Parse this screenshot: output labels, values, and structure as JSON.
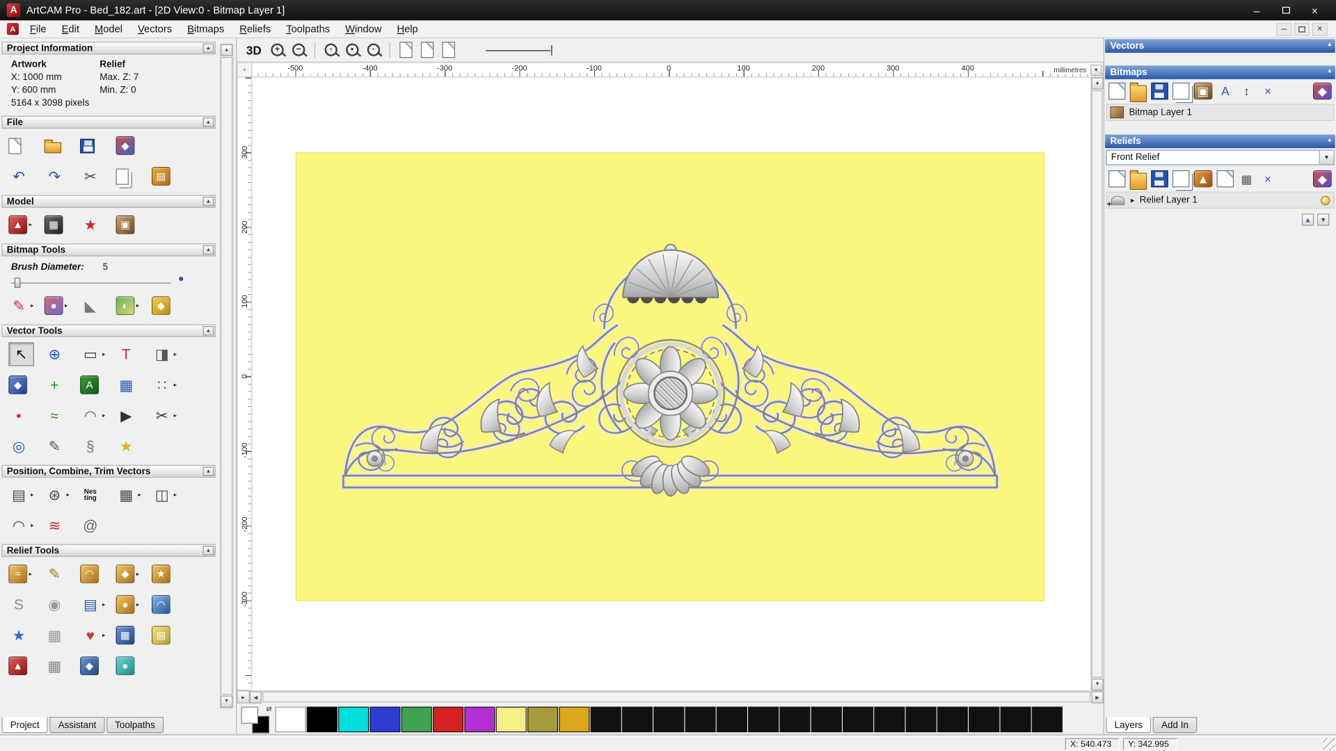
{
  "window": {
    "title": "ArtCAM Pro - Bed_182.art - [2D View:0 - Bitmap Layer 1]",
    "app_icon_letter": "A",
    "controls": {
      "minimize": "–",
      "close": "×"
    }
  },
  "ui": {
    "up": "▲",
    "down": "▼",
    "left": "◀",
    "right": "▶",
    "flyout": "▸",
    "dd": "▼",
    "corner": "+",
    "expander": "▸",
    "link": "⇄",
    "plus": "+"
  },
  "menu": {
    "items": [
      "File",
      "Edit",
      "Model",
      "Vectors",
      "Bitmaps",
      "Reliefs",
      "Toolpaths",
      "Window",
      "Help"
    ]
  },
  "left_panel": {
    "project_info": {
      "title": "Project Information",
      "artwork_label": "Artwork",
      "relief_label": "Relief",
      "x": "X: 1000 mm",
      "y": "Y: 600 mm",
      "max_z": "Max. Z: 7",
      "min_z": "Min. Z: 0",
      "pixels": "5164 x 3098 pixels"
    },
    "file": {
      "title": "File",
      "row1": [
        {
          "name": "new-model-icon",
          "kind": "doc"
        },
        {
          "name": "open-model-icon",
          "kind": "folder"
        },
        {
          "name": "save-model-icon",
          "kind": "save"
        },
        {
          "name": "import-model-icon",
          "kind": "badge",
          "glyph": "◆",
          "grad": [
            "#d05050",
            "#3b62c4"
          ]
        }
      ],
      "row2": [
        {
          "name": "undo-icon",
          "kind": "glyph",
          "glyph": "↶",
          "fg": "#2458b0"
        },
        {
          "name": "redo-icon",
          "kind": "glyph",
          "glyph": "↷",
          "fg": "#2458b0"
        },
        {
          "name": "cut-icon",
          "kind": "glyph",
          "glyph": "✂",
          "fg": "#444444"
        },
        {
          "name": "copy-icon",
          "kind": "doc2"
        },
        {
          "name": "paste-icon",
          "kind": "badge",
          "glyph": "▤",
          "grad": [
            "#e8b040",
            "#b06a20"
          ]
        }
      ]
    },
    "model": {
      "title": "Model",
      "row1": [
        {
          "name": "greyscale-model-icon",
          "kind": "badge",
          "glyph": "▲",
          "grad": [
            "#e06060",
            "#8a1010"
          ],
          "flyout": true
        },
        {
          "name": "texture-model-icon",
          "kind": "badge",
          "glyph": "▦",
          "grad": [
            "#666666",
            "#222222"
          ]
        },
        {
          "name": "stamp-model-icon",
          "kind": "glyph",
          "glyph": "★",
          "fg": "#c23030"
        },
        {
          "name": "picture-model-icon",
          "kind": "badge",
          "glyph": "▣",
          "grad": [
            "#caa46a",
            "#6a4a2a"
          ]
        }
      ]
    },
    "bitmap_tools": {
      "title": "Bitmap Tools",
      "brush_label": "Brush Diameter:",
      "brush_value": "5",
      "row1": [
        {
          "name": "paint-icon",
          "kind": "glyph",
          "glyph": "✎",
          "fg": "#c23030",
          "flyout": true
        },
        {
          "name": "colour-palette-icon",
          "kind": "badge",
          "glyph": "●",
          "grad": [
            "#d86a6a",
            "#6a6ad8"
          ],
          "flyout": true
        },
        {
          "name": "colour-picker-icon",
          "kind": "glyph",
          "glyph": "◣",
          "fg": "#777777"
        },
        {
          "name": "paint-selective-icon",
          "kind": "badge",
          "glyph": "◐",
          "grad": [
            "#6ab06a",
            "#d8d86a"
          ],
          "flyout": true
        },
        {
          "name": "flood-fill-icon",
          "kind": "badge",
          "glyph": "◆",
          "grad": [
            "#f0d050",
            "#bf8a20"
          ]
        }
      ]
    },
    "vector_tools": {
      "title": "Vector Tools",
      "row1": [
        {
          "name": "select-vectors-icon",
          "kind": "glyph",
          "glyph": "↖",
          "fg": "#111111",
          "sel": true
        },
        {
          "name": "transform-vectors-icon",
          "kind": "glyph",
          "glyph": "⊕",
          "fg": "#2458b0"
        },
        {
          "name": "create-rectangle-icon",
          "kind": "glyph",
          "glyph": "▭",
          "fg": "#333333",
          "flyout": true
        },
        {
          "name": "create-text-icon",
          "kind": "glyph",
          "glyph": "T",
          "fg": "#c23030"
        },
        {
          "name": "mirror-vectors-icon",
          "kind": "glyph",
          "glyph": "◨",
          "fg": "#555555",
          "flyout": true
        }
      ],
      "row2": [
        {
          "name": "offset-vectors-icon",
          "kind": "badge",
          "glyph": "◆",
          "grad": [
            "#6a8ad8",
            "#24418a"
          ]
        },
        {
          "name": "create-polyline-icon",
          "kind": "glyph",
          "glyph": "+",
          "fg": "#169016"
        },
        {
          "name": "wrap-text-icon",
          "kind": "badge",
          "glyph": "A",
          "grad": [
            "#3a9a3a",
            "#1a5a1a"
          ]
        },
        {
          "name": "paste-along-curve-icon",
          "kind": "glyph",
          "glyph": "▦",
          "fg": "#2458b0"
        },
        {
          "name": "array-copy-icon",
          "kind": "glyph",
          "glyph": "∷",
          "fg": "#c23030",
          "flyout": true
        }
      ],
      "row3": [
        {
          "name": "create-dot-icon",
          "kind": "glyph",
          "glyph": "•",
          "fg": "#c23030"
        },
        {
          "name": "freehand-draw-icon",
          "kind": "glyph",
          "glyph": "≈",
          "fg": "#169016"
        },
        {
          "name": "create-arc-icon",
          "kind": "glyph",
          "glyph": "◠",
          "fg": "#555555",
          "flyout": true
        },
        {
          "name": "create-polyline-arrow-icon",
          "kind": "glyph",
          "glyph": "▶",
          "fg": "#333333"
        },
        {
          "name": "trim-vectors-icon",
          "kind": "glyph",
          "glyph": "✂",
          "fg": "#333333",
          "flyout": true
        }
      ],
      "row4": [
        {
          "name": "create-circle-icon",
          "kind": "glyph",
          "glyph": "◎",
          "fg": "#2458b0"
        },
        {
          "name": "fit-curve-icon",
          "kind": "glyph",
          "glyph": "✎",
          "fg": "#555555"
        },
        {
          "name": "measure-icon",
          "kind": "glyph",
          "glyph": "§",
          "fg": "#777777"
        },
        {
          "name": "create-star-icon",
          "kind": "glyph",
          "glyph": "★",
          "fg": "#e0b020"
        }
      ]
    },
    "position_tools": {
      "title": "Position, Combine, Trim Vectors",
      "row1": [
        {
          "name": "align-vectors-icon",
          "kind": "glyph",
          "glyph": "▤",
          "fg": "#444444",
          "flyout": true
        },
        {
          "name": "block-rotate-copy-icon",
          "kind": "glyph",
          "glyph": "⊛",
          "fg": "#444444",
          "flyout": true
        },
        {
          "name": "nesting-icon",
          "kind": "smalltext",
          "glyph": "Nes\nting"
        },
        {
          "name": "block-array-copy-icon",
          "kind": "glyph",
          "glyph": "▦",
          "fg": "#444444",
          "flyout": true
        },
        {
          "name": "group-vectors-icon",
          "kind": "glyph",
          "glyph": "◫",
          "fg": "#444444",
          "flyout": true
        }
      ],
      "row2": [
        {
          "name": "join-vectors-icon",
          "kind": "glyph",
          "glyph": "◠",
          "fg": "#444444",
          "flyout": true
        },
        {
          "name": "envelope-distort-icon",
          "kind": "glyph",
          "glyph": "≋",
          "fg": "#c23030"
        },
        {
          "name": "wrap-spiral-icon",
          "kind": "glyph",
          "glyph": "@",
          "fg": "#666666"
        }
      ]
    },
    "relief_tools": {
      "title": "Relief Tools",
      "row1": [
        {
          "name": "sculpt-relief-icon",
          "kind": "badge",
          "glyph": "≈",
          "grad": [
            "#f0c860",
            "#a87020"
          ],
          "flyout": true
        },
        {
          "name": "carve-relief-icon",
          "kind": "glyph",
          "glyph": "✎",
          "fg": "#a87820"
        },
        {
          "name": "extrude-relief-icon",
          "kind": "badge",
          "glyph": "◠",
          "grad": [
            "#f0c860",
            "#a87020"
          ]
        },
        {
          "name": "turn-relief-icon",
          "kind": "badge",
          "glyph": "◆",
          "grad": [
            "#f0c860",
            "#a87020"
          ],
          "flyout": true
        },
        {
          "name": "two-rail-sweep-icon",
          "kind": "badge",
          "glyph": "★",
          "grad": [
            "#f0c860",
            "#a87020"
          ]
        }
      ],
      "row2": [
        {
          "name": "smooth-relief-icon",
          "kind": "glyph",
          "glyph": "S",
          "fg": "#8a8a8a"
        },
        {
          "name": "weave-relief-icon",
          "kind": "glyph",
          "glyph": "◉",
          "fg": "#9a9a9a"
        },
        {
          "name": "relief-layer-stack-icon",
          "kind": "glyph",
          "glyph": "▤",
          "fg": "#2458b0",
          "flyout": true
        },
        {
          "name": "add-clay-icon",
          "kind": "badge",
          "glyph": "●",
          "grad": [
            "#f0c860",
            "#a87020"
          ],
          "flyout": true
        },
        {
          "name": "dome-relief-icon",
          "kind": "badge",
          "glyph": "◠",
          "grad": [
            "#8ab4e8",
            "#2a5a9a"
          ]
        }
      ],
      "row3": [
        {
          "name": "texture-star-icon",
          "kind": "glyph",
          "glyph": "★",
          "fg": "#3a6ac4"
        },
        {
          "name": "mesh-relief-icon",
          "kind": "glyph",
          "glyph": "▦",
          "fg": "#9a9a9a"
        },
        {
          "name": "petal-relief-icon",
          "kind": "glyph",
          "glyph": "♥",
          "fg": "#c04040",
          "flyout": true
        },
        {
          "name": "texture-area-icon",
          "kind": "badge",
          "glyph": "▦",
          "grad": [
            "#6a94d4",
            "#24487e"
          ]
        },
        {
          "name": "offset-relief-icon",
          "kind": "badge",
          "glyph": "▤",
          "grad": [
            "#f0e080",
            "#baa030"
          ]
        }
      ],
      "row4": [
        {
          "name": "clipart-relief-icon",
          "kind": "badge",
          "glyph": "▲",
          "grad": [
            "#e06060",
            "#8a1010"
          ]
        },
        {
          "name": "grid-relief-icon",
          "kind": "glyph",
          "glyph": "▦",
          "fg": "#888888"
        },
        {
          "name": "blue-relief-icon",
          "kind": "badge",
          "glyph": "◆",
          "grad": [
            "#6a94d4",
            "#24487e"
          ]
        },
        {
          "name": "teal-relief-icon",
          "kind": "badge",
          "glyph": "●",
          "grad": [
            "#6ad4d4",
            "#248a8a"
          ]
        }
      ]
    },
    "tabs": [
      "Project",
      "Assistant",
      "Toolpaths"
    ]
  },
  "canvas": {
    "toolbar": {
      "view_3d": "3D",
      "items": [
        {
          "name": "zoom-in-icon",
          "kind": "lens",
          "glyph": "+"
        },
        {
          "name": "zoom-out-icon",
          "kind": "lens",
          "glyph": "−"
        },
        {
          "kind": "sep"
        },
        {
          "name": "zoom-objects-icon",
          "kind": "lens",
          "glyph": "▫"
        },
        {
          "name": "zoom-drawing-icon",
          "kind": "lens",
          "glyph": "▪"
        },
        {
          "name": "zoom-previous-icon",
          "kind": "lens",
          "glyph": "·"
        },
        {
          "kind": "sep"
        },
        {
          "name": "page-snap-icon",
          "kind": "doc"
        },
        {
          "name": "page-grid-icon",
          "kind": "doc"
        },
        {
          "name": "page-preview-icon",
          "kind": "doc"
        }
      ]
    },
    "ruler_top": {
      "labels": [
        "-500",
        "-400",
        "-300",
        "-200",
        "-100",
        "0",
        "100",
        "200",
        "300",
        "400"
      ],
      "unit": "millimetres"
    },
    "ruler_left": {
      "labels": [
        "300",
        "200",
        "100",
        "0",
        "-100",
        "-200",
        "-300"
      ]
    }
  },
  "right_panel": {
    "vectors": {
      "title": "Vectors"
    },
    "bitmaps": {
      "title": "Bitmaps",
      "layer_label": "Bitmap Layer 1",
      "toolbar": [
        {
          "name": "new-bitmap-layer-icon",
          "kind": "doc"
        },
        {
          "name": "open-bitmap-layer-icon",
          "kind": "folder"
        },
        {
          "name": "save-bitmap-layer-icon",
          "kind": "save"
        },
        {
          "name": "duplicate-bitmap-layer-icon",
          "kind": "doc2"
        },
        {
          "name": "bitmap-colour-icon",
          "kind": "badge",
          "glyph": "▣",
          "grad": [
            "#caa46a",
            "#6a4a2a"
          ]
        },
        {
          "name": "bitmap-text-icon",
          "kind": "glyph",
          "glyph": "A",
          "fg": "#2458b0"
        },
        {
          "name": "bitmap-transfer-icon",
          "kind": "glyph",
          "glyph": "↕",
          "fg": "#444444"
        },
        {
          "name": "delete-bitmap-layer-icon",
          "kind": "glyph",
          "glyph": "×",
          "fg": "#2458b0"
        },
        {
          "name": "bitmap-options-icon",
          "kind": "badge",
          "glyph": "◆",
          "grad": [
            "#d05050",
            "#5050d0"
          ],
          "right": true
        }
      ]
    },
    "reliefs": {
      "title": "Reliefs",
      "combo_value": "Front Relief",
      "layer_label": "Relief Layer 1",
      "toolbar": [
        {
          "name": "new-relief-layer-icon",
          "kind": "doc"
        },
        {
          "name": "open-relief-layer-icon",
          "kind": "folder"
        },
        {
          "name": "save-relief-layer-icon",
          "kind": "save"
        },
        {
          "name": "duplicate-relief-layer-icon",
          "kind": "doc2"
        },
        {
          "name": "calculate-relief-icon",
          "kind": "badge",
          "glyph": "▲",
          "grad": [
            "#e0a040",
            "#a05010"
          ]
        },
        {
          "name": "relief-sheet-icon",
          "kind": "doc"
        },
        {
          "name": "relief-calculator-icon",
          "kind": "glyph",
          "glyph": "▦",
          "fg": "#555555"
        },
        {
          "name": "delete-relief-layer-icon",
          "kind": "glyph",
          "glyph": "×",
          "fg": "#2458b0"
        },
        {
          "name": "relief-options-icon",
          "kind": "badge",
          "glyph": "◆",
          "grad": [
            "#d05050",
            "#5050d0"
          ],
          "right": true
        }
      ]
    },
    "tabs": [
      "Layers",
      "Add In"
    ]
  },
  "status_bar": {
    "x_readout": "X: 540.473",
    "y_readout": "Y: 342.995"
  },
  "palette": {
    "colors": [
      "#ffffff",
      "#000000",
      "#00dede",
      "#2e3cd4",
      "#3ea353",
      "#d62121",
      "#b32fd4",
      "#f4ef86",
      "#a59a3c",
      "#dca81e",
      "#111111",
      "#111111",
      "#111111",
      "#111111",
      "#111111",
      "#111111",
      "#111111",
      "#111111",
      "#111111",
      "#111111",
      "#111111",
      "#111111",
      "#111111",
      "#111111",
      "#111111"
    ]
  }
}
